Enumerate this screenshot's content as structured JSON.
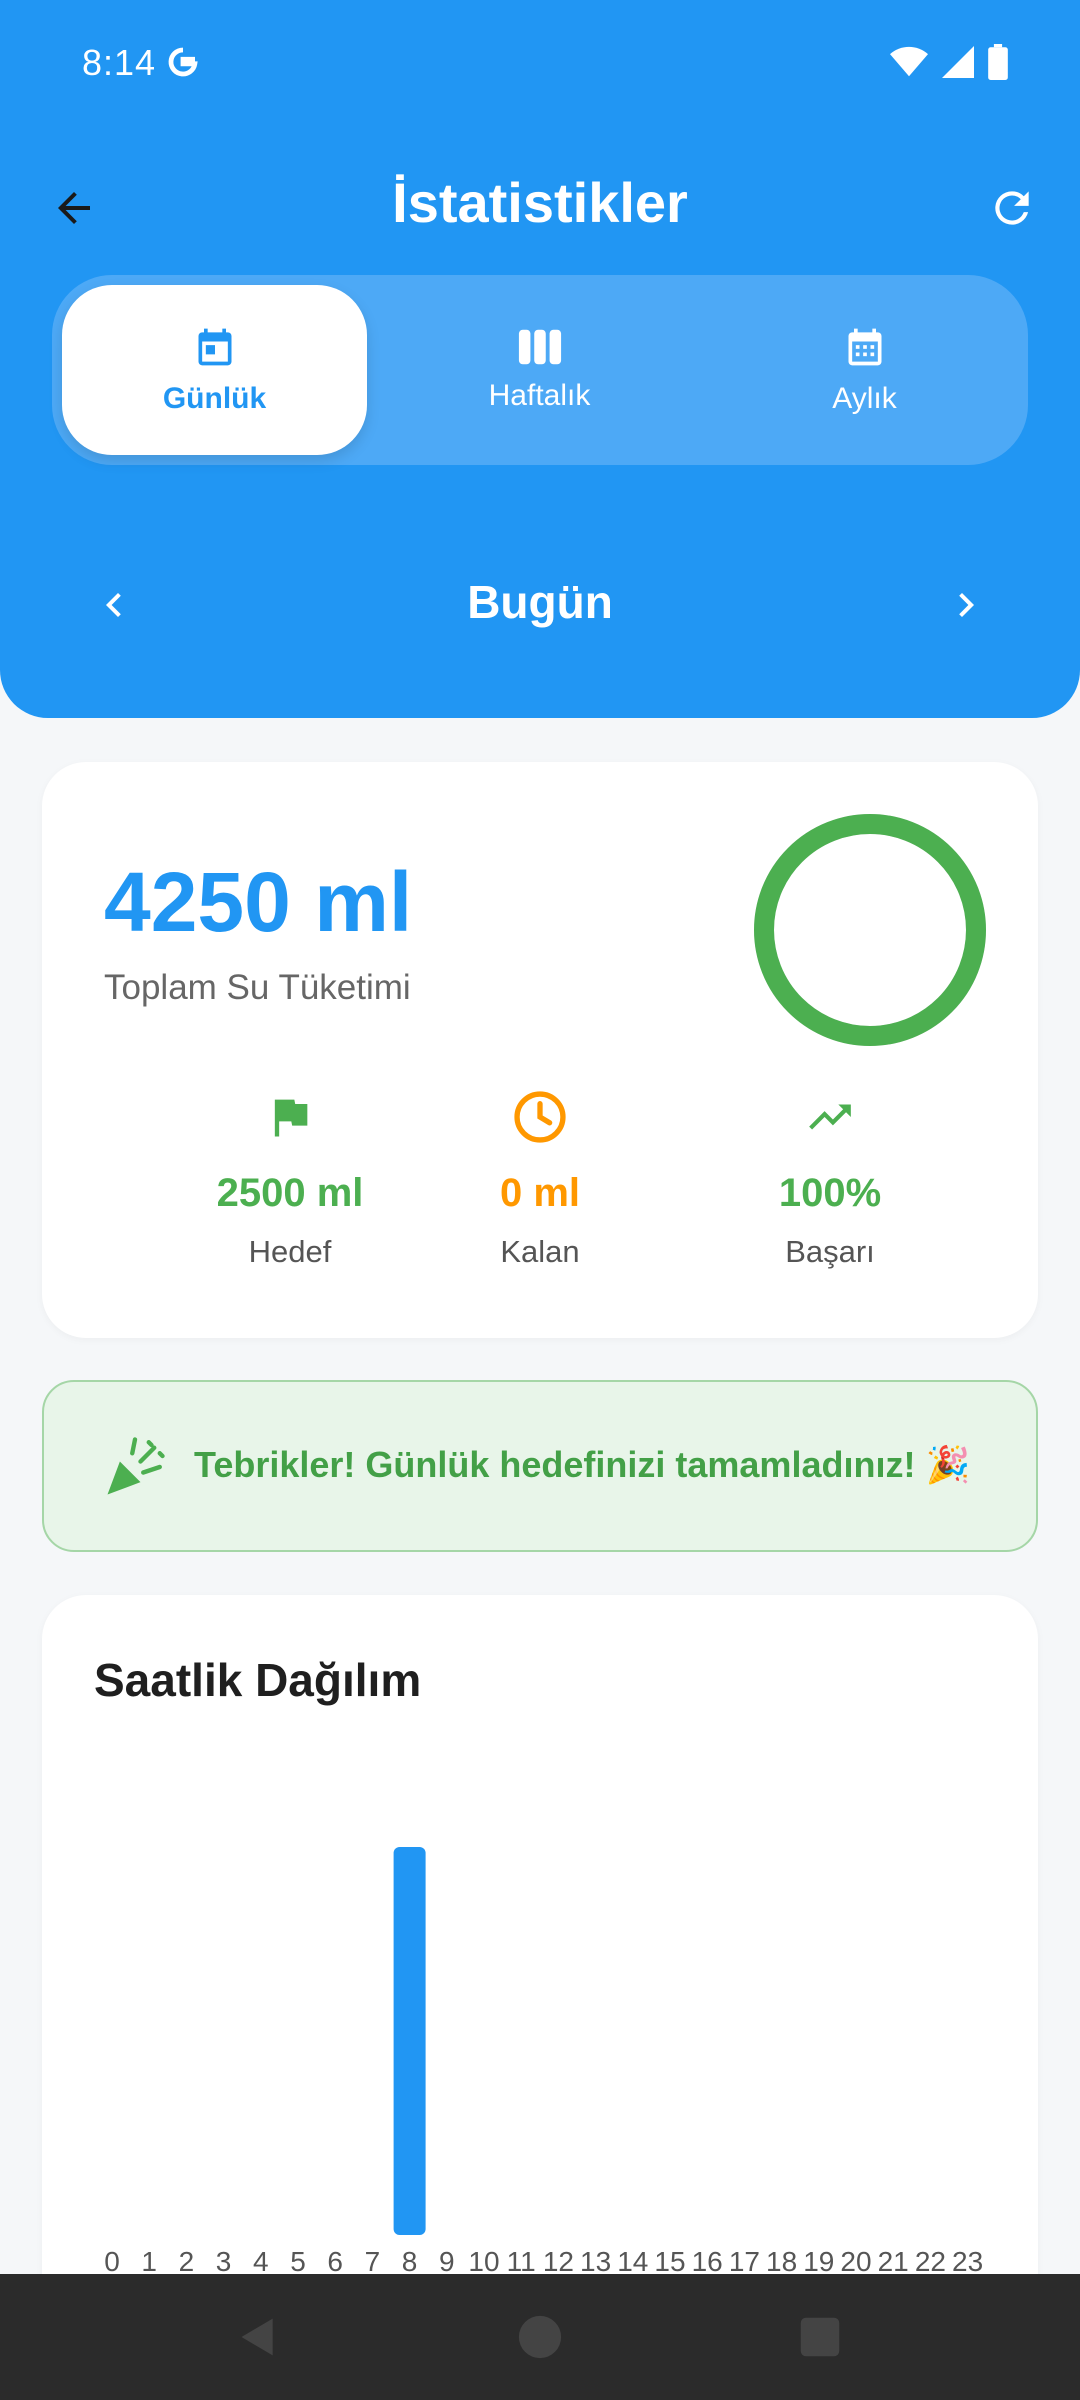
{
  "status_bar": {
    "time": "8:14"
  },
  "appbar": {
    "title": "İstatistikler"
  },
  "tabs": [
    {
      "label": "Günlük",
      "icon": "calendar-today-icon",
      "active": true
    },
    {
      "label": "Haftalık",
      "icon": "week-columns-icon",
      "active": false
    },
    {
      "label": "Aylık",
      "icon": "calendar-month-icon",
      "active": false
    }
  ],
  "date_nav": {
    "label": "Bugün"
  },
  "summary": {
    "total_value": "4250 ml",
    "total_label": "Toplam Su Tüketimi",
    "progress": 1.0,
    "ring_color": "#4CAF50",
    "stats": [
      {
        "value": "2500 ml",
        "label": "Hedef",
        "icon": "flag-icon",
        "color": "#4CAF50"
      },
      {
        "value": "0 ml",
        "label": "Kalan",
        "icon": "clock-icon",
        "color": "#FF9800"
      },
      {
        "value": "100%",
        "label": "Başarı",
        "icon": "trending-up-icon",
        "color": "#4CAF50"
      }
    ]
  },
  "congrats": {
    "text": "Tebrikler! Günlük hedefinizi tamamladınız! 🎉"
  },
  "chart_data": {
    "type": "bar",
    "title": "Saatlik Dağılım",
    "xlabel": "",
    "ylabel": "",
    "categories": [
      "0",
      "1",
      "2",
      "3",
      "4",
      "5",
      "6",
      "7",
      "8",
      "9",
      "10",
      "11",
      "12",
      "13",
      "14",
      "15",
      "16",
      "17",
      "18",
      "19",
      "20",
      "21",
      "22",
      "23"
    ],
    "values": [
      0,
      0,
      0,
      0,
      0,
      0,
      0,
      0,
      4250,
      0,
      0,
      0,
      0,
      0,
      0,
      0,
      0,
      0,
      0,
      0,
      0,
      0,
      0,
      0
    ],
    "color": "#2196F3",
    "grid": false
  },
  "colors": {
    "primary": "#2196F3",
    "success": "#4CAF50",
    "warning": "#FF9800"
  }
}
